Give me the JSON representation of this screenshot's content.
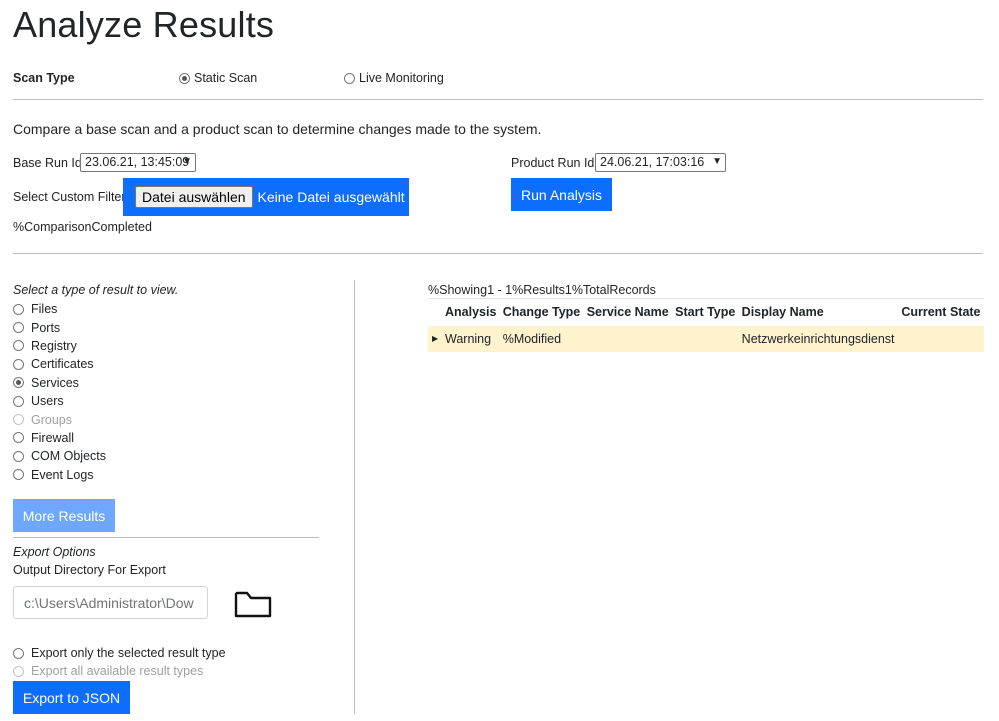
{
  "page": {
    "title": "Analyze Results"
  },
  "scan_type": {
    "label": "Scan Type",
    "options": [
      {
        "label": "Static Scan",
        "selected": true
      },
      {
        "label": "Live Monitoring",
        "selected": false
      }
    ]
  },
  "description": "Compare a base scan and a product scan to determine changes made to the system.",
  "base_run": {
    "label": "Base Run Id",
    "selected": "23.06.21, 13:45:09"
  },
  "product_run": {
    "label": "Product Run Id",
    "selected": "24.06.21, 17:03:16"
  },
  "custom_filter": {
    "label": "Select Custom Filter",
    "button_label": "Datei auswählen",
    "status": "Keine Datei ausgewählt"
  },
  "run_analysis_label": "Run Analysis",
  "comparison_status": "%ComparisonCompleted",
  "result_types": {
    "caption": "Select a type of result to view.",
    "items": [
      {
        "label": "Files",
        "selected": false,
        "disabled": false
      },
      {
        "label": "Ports",
        "selected": false,
        "disabled": false
      },
      {
        "label": "Registry",
        "selected": false,
        "disabled": false
      },
      {
        "label": "Certificates",
        "selected": false,
        "disabled": false
      },
      {
        "label": "Services",
        "selected": true,
        "disabled": false
      },
      {
        "label": "Users",
        "selected": false,
        "disabled": false
      },
      {
        "label": "Groups",
        "selected": false,
        "disabled": true
      },
      {
        "label": "Firewall",
        "selected": false,
        "disabled": false
      },
      {
        "label": "COM Objects",
        "selected": false,
        "disabled": false
      },
      {
        "label": "Event Logs",
        "selected": false,
        "disabled": false
      }
    ]
  },
  "more_results_label": "More Results",
  "export": {
    "caption": "Export Options",
    "dir_label": "Output Directory For Export",
    "dir_value": "c:\\Users\\Administrator\\Dow",
    "folder_icon": "folder-icon",
    "options": [
      {
        "label": "Export only the selected result type",
        "selected": false,
        "disabled": false
      },
      {
        "label": "Export all available result types",
        "selected": false,
        "disabled": true
      }
    ],
    "button_label": "Export to JSON"
  },
  "results": {
    "summary": "%Showing1 - 1%Results1%TotalRecords",
    "columns": [
      "Analysis",
      "Change Type",
      "Service Name",
      "Start Type",
      "Display Name",
      "Current State"
    ],
    "rows": [
      {
        "analysis": "Warning",
        "change_type": "%Modified",
        "service_name": "",
        "start_type": "",
        "display_name": "Netzwerkeinrichtungsdienst",
        "current_state": ""
      }
    ]
  },
  "colors": {
    "primary": "#0d6efd",
    "primary_light": "#6ea8fe",
    "warning_row": "#fff3cd"
  }
}
